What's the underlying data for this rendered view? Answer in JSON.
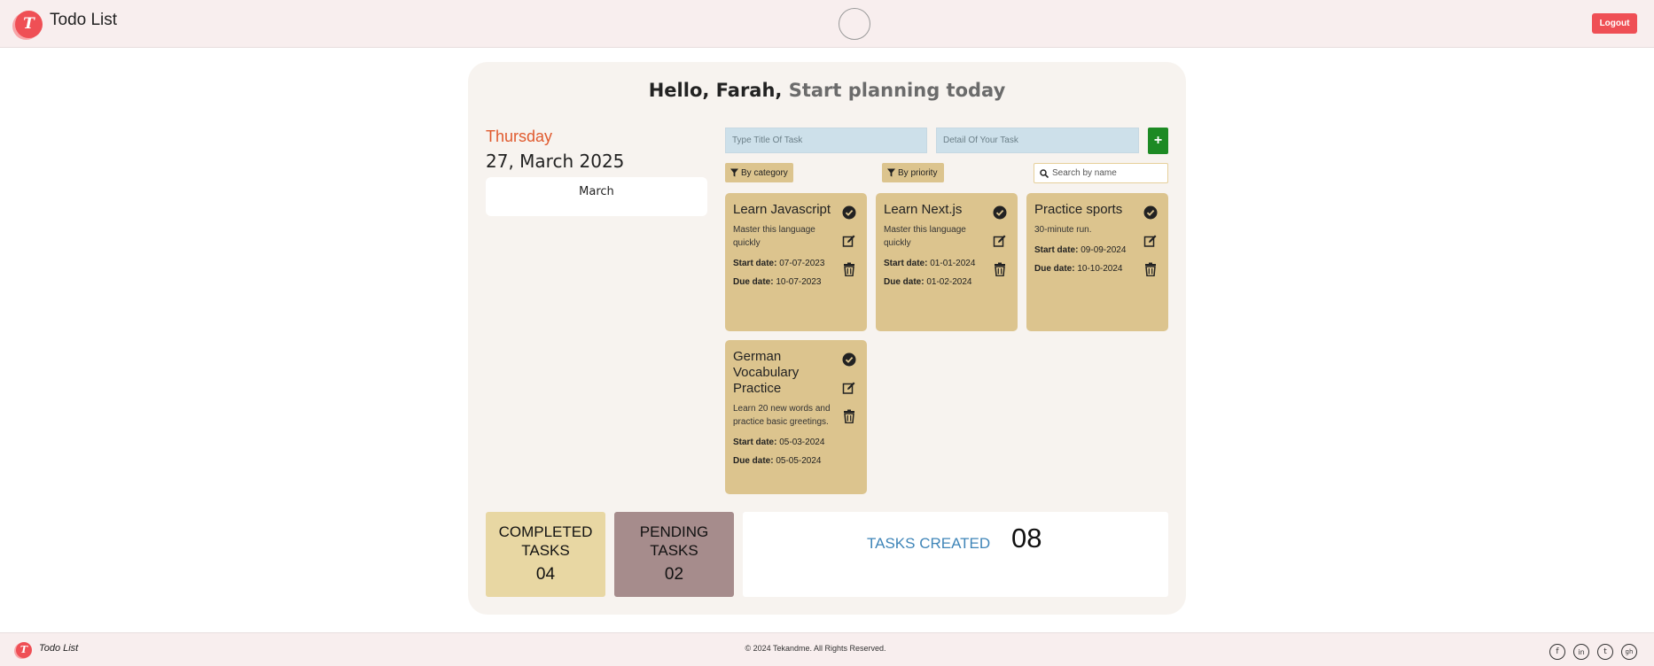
{
  "header": {
    "logo_letter": "T",
    "app_title": "Todo List",
    "logout_label": "Logout"
  },
  "greeting": {
    "hello": "Hello, Farah,",
    "subtitle": "Start planning today"
  },
  "date": {
    "day_name": "Thursday",
    "full_date": "27, March 2025",
    "calendar_month": "March"
  },
  "form": {
    "title_placeholder": "Type Title Of Task",
    "detail_placeholder": "Detail Of Your Task",
    "add_label": "+"
  },
  "filters": {
    "by_category": "By category",
    "by_priority": "By priority",
    "search_placeholder": "Search by name"
  },
  "tasks": [
    {
      "title": "Learn Javascript",
      "description": "Master this language quickly",
      "start_label": "Start date:",
      "start_date": "07-07-2023",
      "due_label": "Due date:",
      "due_date": "10-07-2023"
    },
    {
      "title": "Learn Next.js",
      "description": "Master this language quickly",
      "start_label": "Start date:",
      "start_date": "01-01-2024",
      "due_label": "Due date:",
      "due_date": "01-02-2024"
    },
    {
      "title": "Practice sports",
      "description": "30-minute run.",
      "start_label": "Start date:",
      "start_date": "09-09-2024",
      "due_label": "Due date:",
      "due_date": "10-10-2024"
    },
    {
      "title": "German Vocabulary Practice",
      "description": "Learn 20 new words and practice basic greetings.",
      "start_label": "Start date:",
      "start_date": "05-03-2024",
      "due_label": "Due date:",
      "due_date": "05-05-2024"
    }
  ],
  "stats": {
    "completed_label": "COMPLETED TASKS",
    "completed_value": "04",
    "pending_label": "PENDING TASKS",
    "pending_value": "02",
    "created_label": "TASKS CREATED",
    "created_value": "08"
  },
  "footer": {
    "logo_letter": "T",
    "title": "Todo List",
    "copyright": "© 2024 Tekandme. All Rights Reserved.",
    "social": [
      {
        "icon": "facebook-icon",
        "glyph": "f"
      },
      {
        "icon": "linkedin-icon",
        "glyph": "in"
      },
      {
        "icon": "twitter-icon",
        "glyph": "t"
      },
      {
        "icon": "github-icon",
        "glyph": "gh"
      }
    ]
  },
  "colors": {
    "accent_red": "#ef4f55",
    "card_bg": "#dcc48e",
    "add_green": "#1d8a24",
    "day_orange": "#e05a2e",
    "created_blue": "#3f85b8"
  }
}
